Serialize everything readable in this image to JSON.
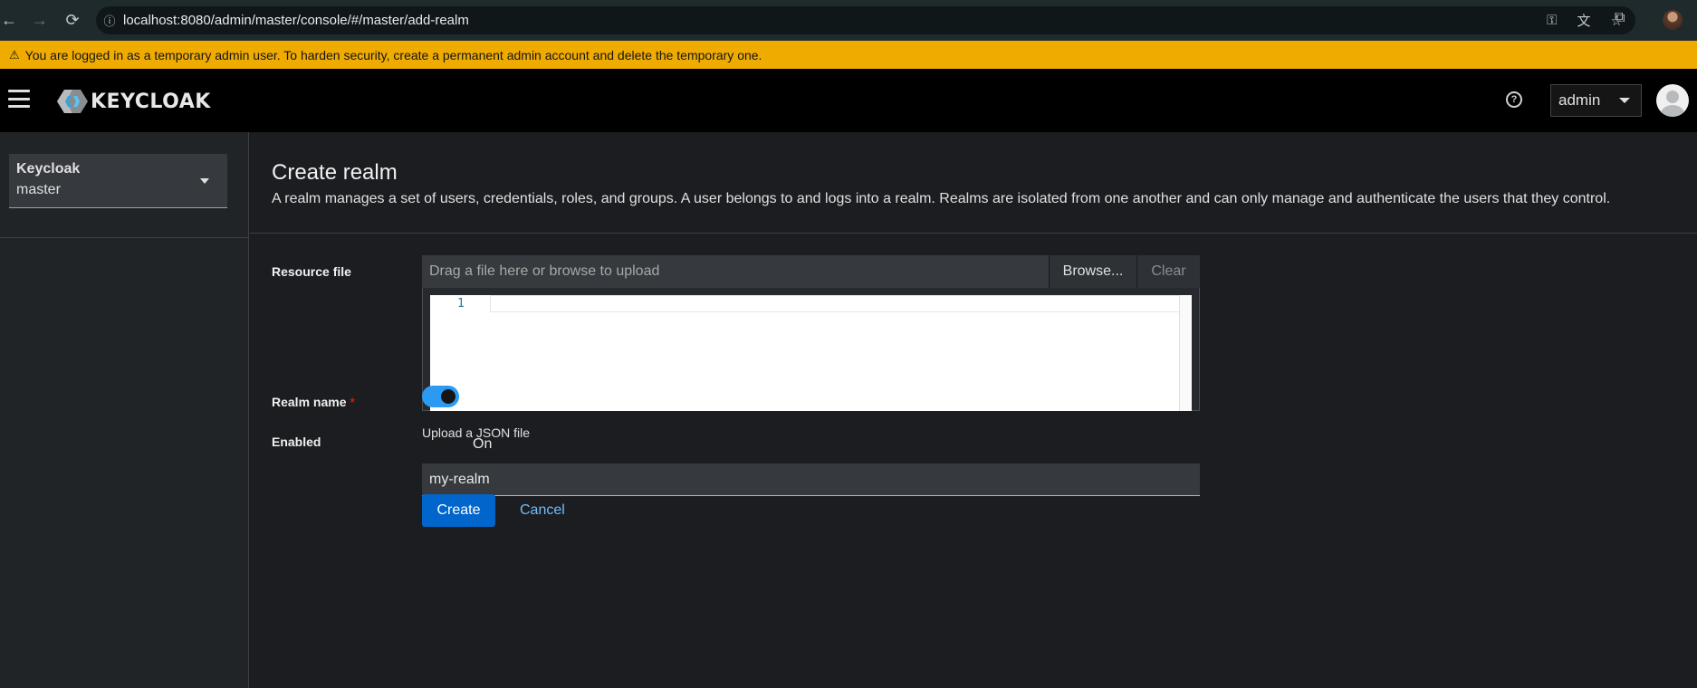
{
  "browser": {
    "url": "localhost:8080/admin/master/console/#/master/add-realm",
    "back_glyph": "←",
    "forward_glyph": "→",
    "reload_glyph": "⟳",
    "info_glyph": "ⓘ",
    "key_glyph": "⚿",
    "translate_glyph": "文",
    "star_glyph": "☆",
    "extensions_glyph": "⧉"
  },
  "banner": {
    "icon": "⚠",
    "text": "You are logged in as a temporary admin user. To harden security, create a permanent admin account and delete the temporary one.",
    "color": "#f0ab00"
  },
  "masthead": {
    "logo_text": "KEYCLOAK",
    "help_glyph": "?",
    "user_label": "admin"
  },
  "sidebar": {
    "realm_selector": {
      "title": "Keycloak",
      "value": "master"
    }
  },
  "main": {
    "title": "Create realm",
    "description": "A realm manages a set of users, credentials, roles, and groups. A user belongs to and logs into a realm. Realms are isolated from one another and can only manage and authenticate the users that they control.",
    "resource_file": {
      "label": "Resource file",
      "placeholder": "Drag a file here or browse to upload",
      "browse_label": "Browse...",
      "clear_label": "Clear",
      "line_number": "1",
      "helper": "Upload a JSON file"
    },
    "realm_name": {
      "label": "Realm name",
      "required_mark": "*",
      "value": "my-realm"
    },
    "enabled": {
      "label": "Enabled",
      "state": "On",
      "checked": true,
      "accent": "#2b9af3"
    },
    "actions": {
      "create_label": "Create",
      "cancel_label": "Cancel",
      "primary_color": "#0066cc"
    }
  }
}
